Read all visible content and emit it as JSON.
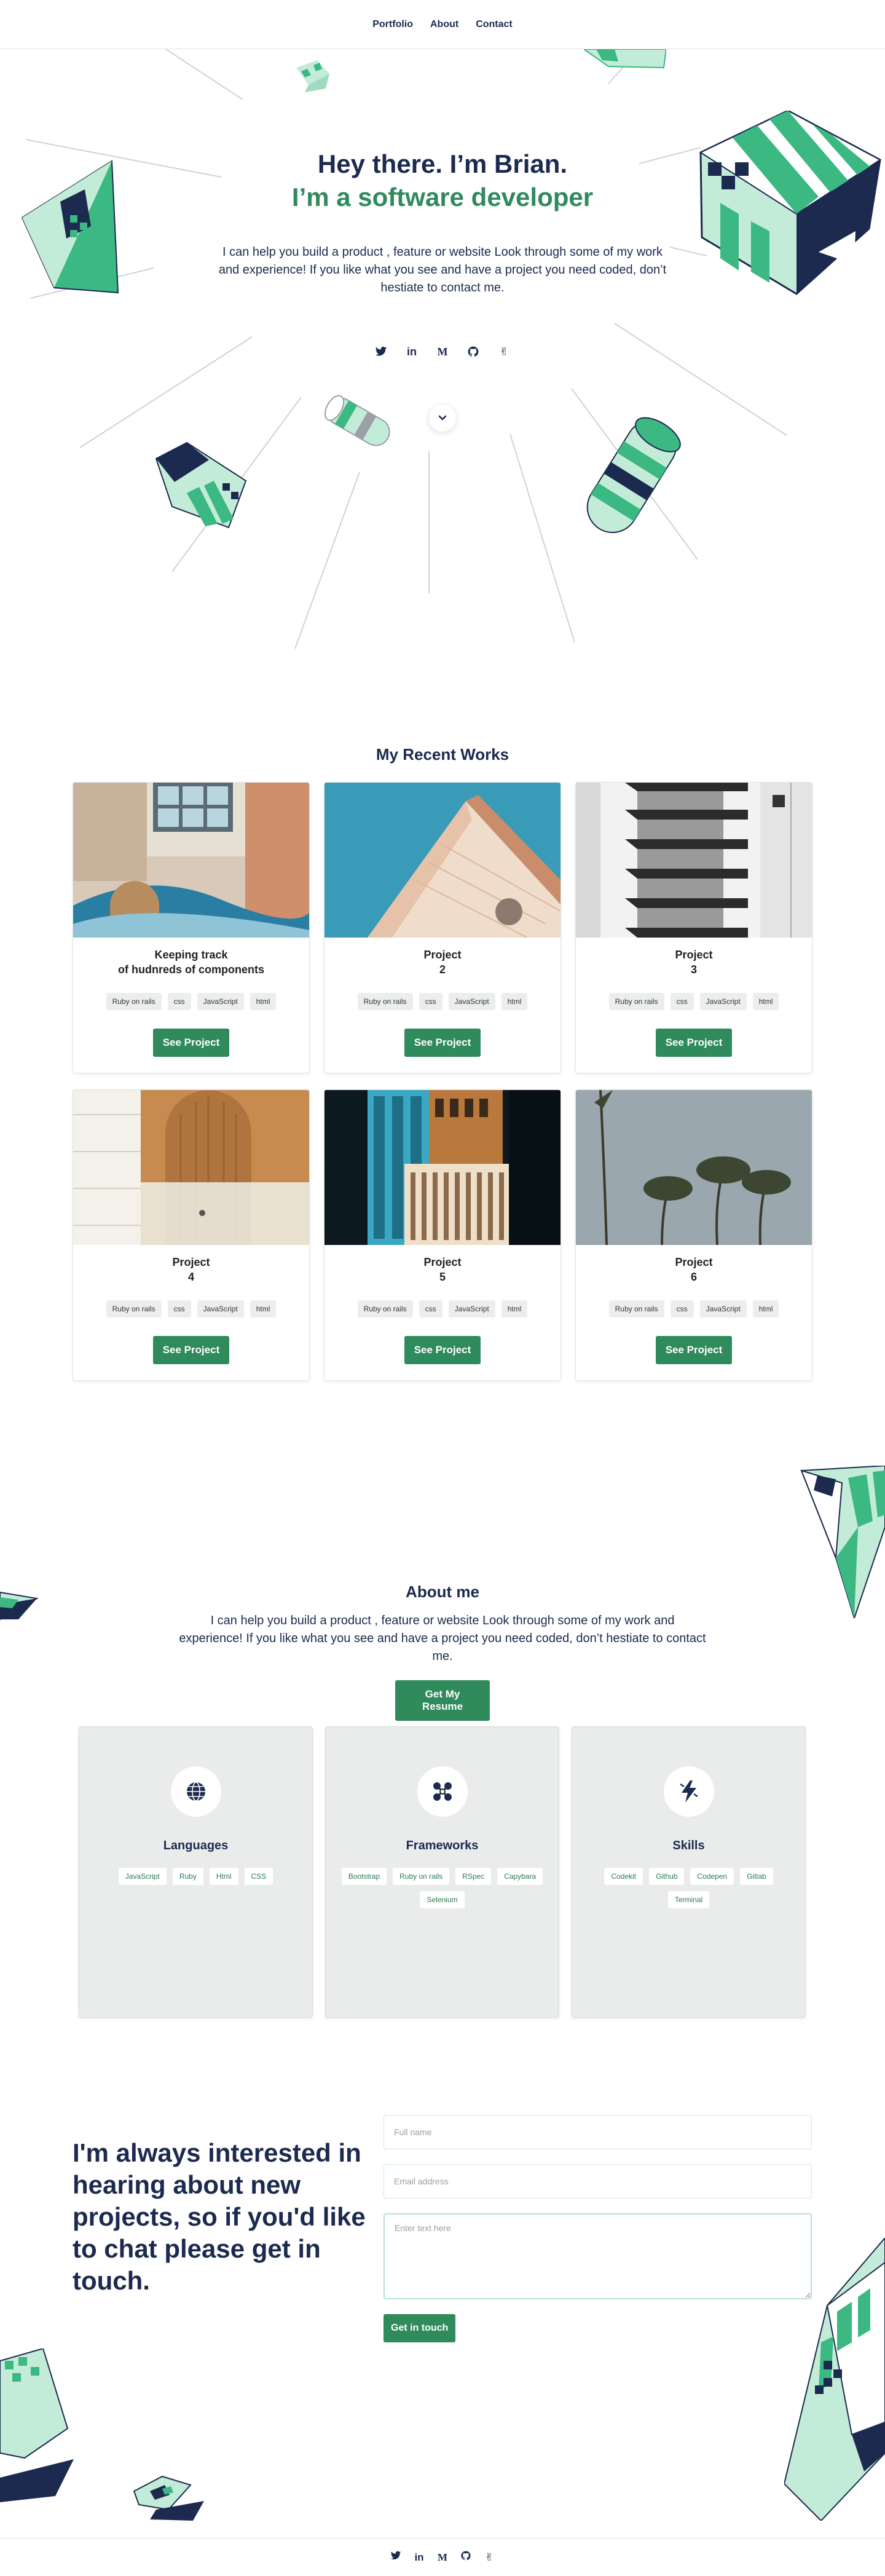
{
  "nav": {
    "items": [
      {
        "label": "Portfolio"
      },
      {
        "label": "About"
      },
      {
        "label": "Contact"
      }
    ]
  },
  "hero": {
    "greeting": "Hey there. I’m Brian.",
    "role": "I’m a software developer",
    "intro": "I can help you build a product , feature or website Look through some of my work and experience! If you like what you see and have a project you need coded, don’t hestiate to contact me.",
    "socials": [
      {
        "icon": "twitter-icon"
      },
      {
        "icon": "linkedin-icon"
      },
      {
        "icon": "medium-icon"
      },
      {
        "icon": "github-icon"
      },
      {
        "icon": "angellist-icon"
      }
    ]
  },
  "works": {
    "title": "My Recent Works",
    "button_label": "See Project",
    "projects": [
      {
        "title": "Keeping track\nof hudnreds of components",
        "tags": [
          "Ruby on rails",
          "css",
          "JavaScript",
          "html"
        ]
      },
      {
        "title": "Project\n2",
        "tags": [
          "Ruby on rails",
          "css",
          "JavaScript",
          "html"
        ]
      },
      {
        "title": "Project\n3",
        "tags": [
          "Ruby on rails",
          "css",
          "JavaScript",
          "html"
        ]
      },
      {
        "title": "Project\n4",
        "tags": [
          "Ruby on rails",
          "css",
          "JavaScript",
          "html"
        ]
      },
      {
        "title": "Project\n5",
        "tags": [
          "Ruby on rails",
          "css",
          "JavaScript",
          "html"
        ]
      },
      {
        "title": "Project\n6",
        "tags": [
          "Ruby on rails",
          "css",
          "JavaScript",
          "html"
        ]
      }
    ]
  },
  "about": {
    "title": "About me",
    "text": "I can help you build a product , feature or website Look through some of my work and experience! If you like what you see and have a project you need coded, don’t hestiate to contact me.",
    "resume_label": "Get My Resume",
    "cards": [
      {
        "title": "Languages",
        "icon": "globe-icon",
        "tags": [
          "JavaScript",
          "Ruby",
          "Html",
          "CSS"
        ]
      },
      {
        "title": "Frameworks",
        "icon": "framework-nodes-icon",
        "tags": [
          "Bootstrap",
          "Ruby on rails",
          "RSpec",
          "Capybara",
          "Selenium"
        ]
      },
      {
        "title": "Skills",
        "icon": "lightning-icon",
        "tags": [
          "Codekit",
          "Github",
          "Codepen",
          "Gitlab",
          "Terminal"
        ]
      }
    ]
  },
  "contact": {
    "heading": "I'm always interested in hearing about new projects, so if you'd like to chat please get in touch.",
    "name_placeholder": "Full name",
    "email_placeholder": "Email address",
    "message_placeholder": "Enter text here",
    "submit_label": "Get in touch"
  },
  "colors": {
    "navy": "#1b2a4e",
    "green": "#2f8a5c",
    "mint": "#3cb882",
    "mint_light": "#c3ecd8"
  }
}
